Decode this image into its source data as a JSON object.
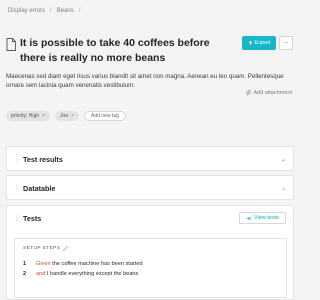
{
  "breadcrumb": {
    "items": [
      "Display errors",
      "Beans"
    ],
    "separator": "/"
  },
  "title": "It is possible to take 40 coffees before there is really no more beans",
  "header_actions": {
    "export_label": "Export",
    "more_label": "···"
  },
  "description": "Maecenas sed diam eget risus varius blandit sit amet non magna. Aenean eu leo quam. Pellentesque ornare sem lacinia quam venenatis vestibulum.",
  "add_attachment_label": "Add attachment",
  "tags": [
    {
      "label": "priority: High"
    },
    {
      "label": "Jira"
    }
  ],
  "add_tag_label": "Add new tag",
  "sections": {
    "test_results": "Test results",
    "datatable": "Datatable",
    "tests": "Tests"
  },
  "view_tests_label": "View tests",
  "setup_steps": {
    "heading": "SETUP STEPS",
    "steps": [
      {
        "number": "1",
        "keyword": "Given",
        "text": "the coffee machine has been started"
      },
      {
        "number": "2",
        "keyword": "and",
        "text": "I handle everything except the beans"
      }
    ]
  },
  "colors": {
    "accent": "#19b6c8",
    "keyword": "#d24a3e",
    "background": "#f4f4f5"
  }
}
